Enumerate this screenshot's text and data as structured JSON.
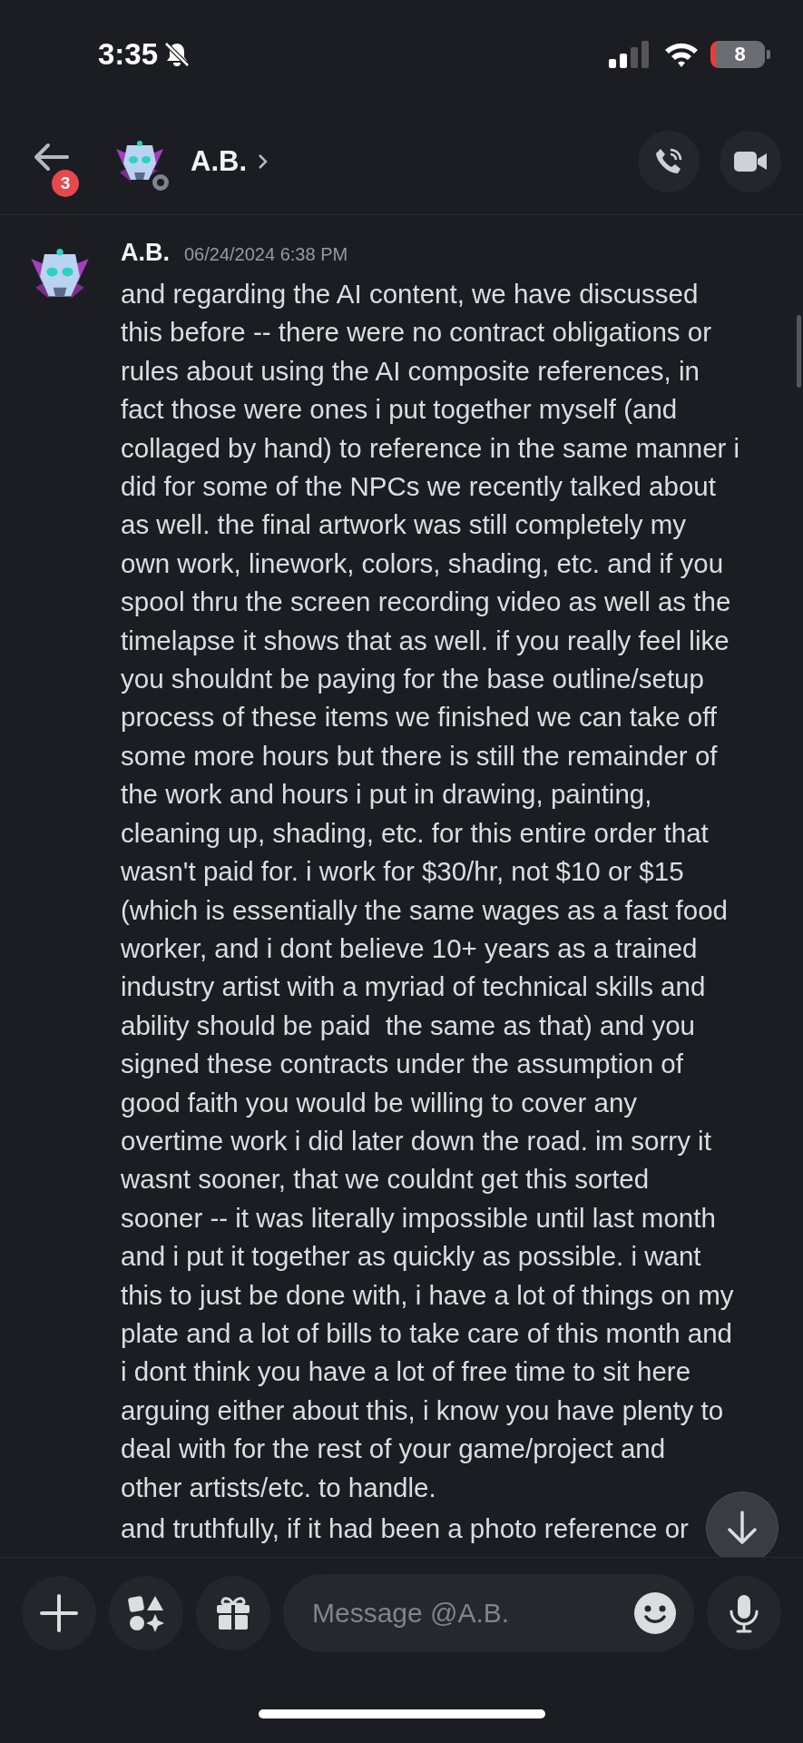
{
  "status_bar": {
    "time": "3:35",
    "battery": "8"
  },
  "header": {
    "unread_badge": "3",
    "title": "A.B."
  },
  "message": {
    "author": "A.B.",
    "timestamp": "06/24/2024 6:38 PM",
    "lines": [
      "and regarding the AI content, we have discussed",
      "this before -- there were no contract obligations or",
      "rules about using the AI composite references, in",
      "fact those were ones i put together myself (and",
      "collaged by hand) to reference in the same manner i",
      "did for some of the NPCs we recently talked about",
      "as well. the final artwork was still completely my",
      "own work, linework, colors, shading, etc. and if you",
      "spool thru the screen recording video as well as the",
      "timelapse it shows that as well. if you really feel like",
      "you shouldnt be paying for the base outline/setup",
      "process of these items we finished we can take off",
      "some more hours but there is still the remainder of",
      "the work and hours i put in drawing, painting,",
      "cleaning up, shading, etc. for this entire order that",
      "wasn't paid for. i work for $30/hr, not $10 or $15",
      "(which is essentially the same wages as a fast food",
      "worker, and i dont believe 10+ years as a trained",
      "industry artist with a myriad of technical skills and",
      "ability should be paid  the same as that) and you",
      "signed these contracts under the assumption of",
      "good faith you would be willing to cover any",
      "overtime work i did later down the road. im sorry it",
      "wasnt sooner, that we couldnt get this sorted",
      "sooner -- it was literally impossible until last month",
      "and i put it together as quickly as possible. i want",
      "this to just be done with, i have a lot of things on my",
      "plate and a lot of bills to take care of this month and",
      "i dont think you have a lot of free time to sit here",
      "arguing either about this, i know you have plenty to",
      "deal with for the rest of your game/project and",
      "other artists/etc. to handle."
    ]
  },
  "next_message": {
    "text": "and truthfully, if it had been a photo reference or"
  },
  "composer": {
    "placeholder": "Message @A.B."
  }
}
